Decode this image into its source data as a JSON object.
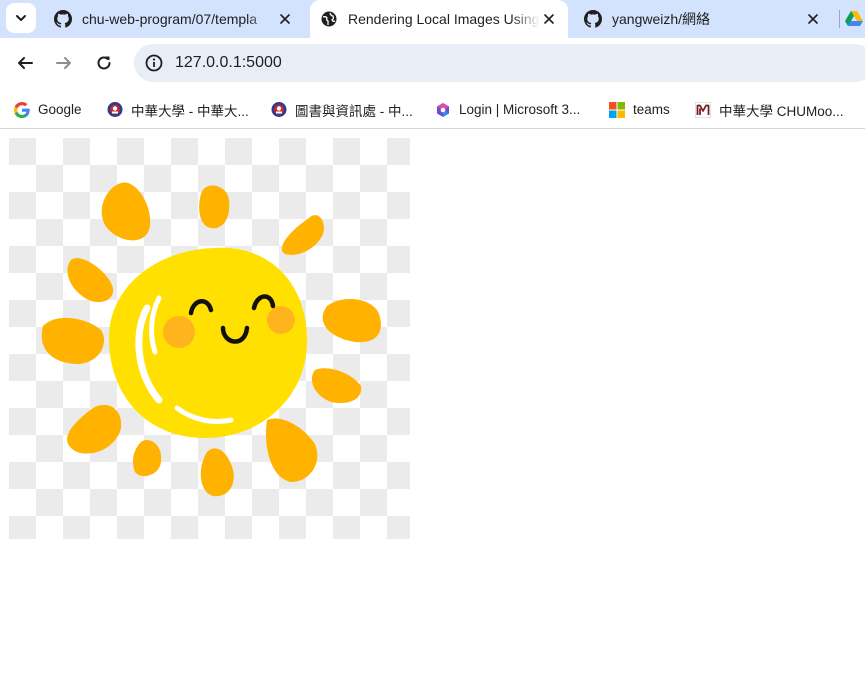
{
  "tabs": [
    {
      "title": "chu-web-program/07/templa",
      "icon": "github-icon",
      "active": false
    },
    {
      "title": "Rendering Local Images Using",
      "icon": "globe-icon",
      "active": true
    },
    {
      "title": "yangweizh/網絡",
      "icon": "github-icon",
      "active": false
    }
  ],
  "address_bar": {
    "url": "127.0.0.1:5000"
  },
  "bookmarks": [
    {
      "label": "Google",
      "icon": "google-icon"
    },
    {
      "label": "中華大學 - 中華大...",
      "icon": "chu-logo-icon"
    },
    {
      "label": "圖書與資訊處 - 中...",
      "icon": "chu-logo-icon"
    },
    {
      "label": "Login | Microsoft 3...",
      "icon": "microsoft365-icon"
    },
    {
      "label": "teams",
      "icon": "microsoft-icon"
    },
    {
      "label": "中華大學 CHUMoo...",
      "icon": "moodle-m-icon"
    }
  ],
  "content": {
    "image": "smiling-sun-illustration"
  },
  "colors": {
    "tabstrip": "#d3e3fd",
    "omnibox": "#e9eef6",
    "sun_body": "#ffe000",
    "sun_rays": "#ffb300",
    "cheeks": "#ffb41e"
  }
}
